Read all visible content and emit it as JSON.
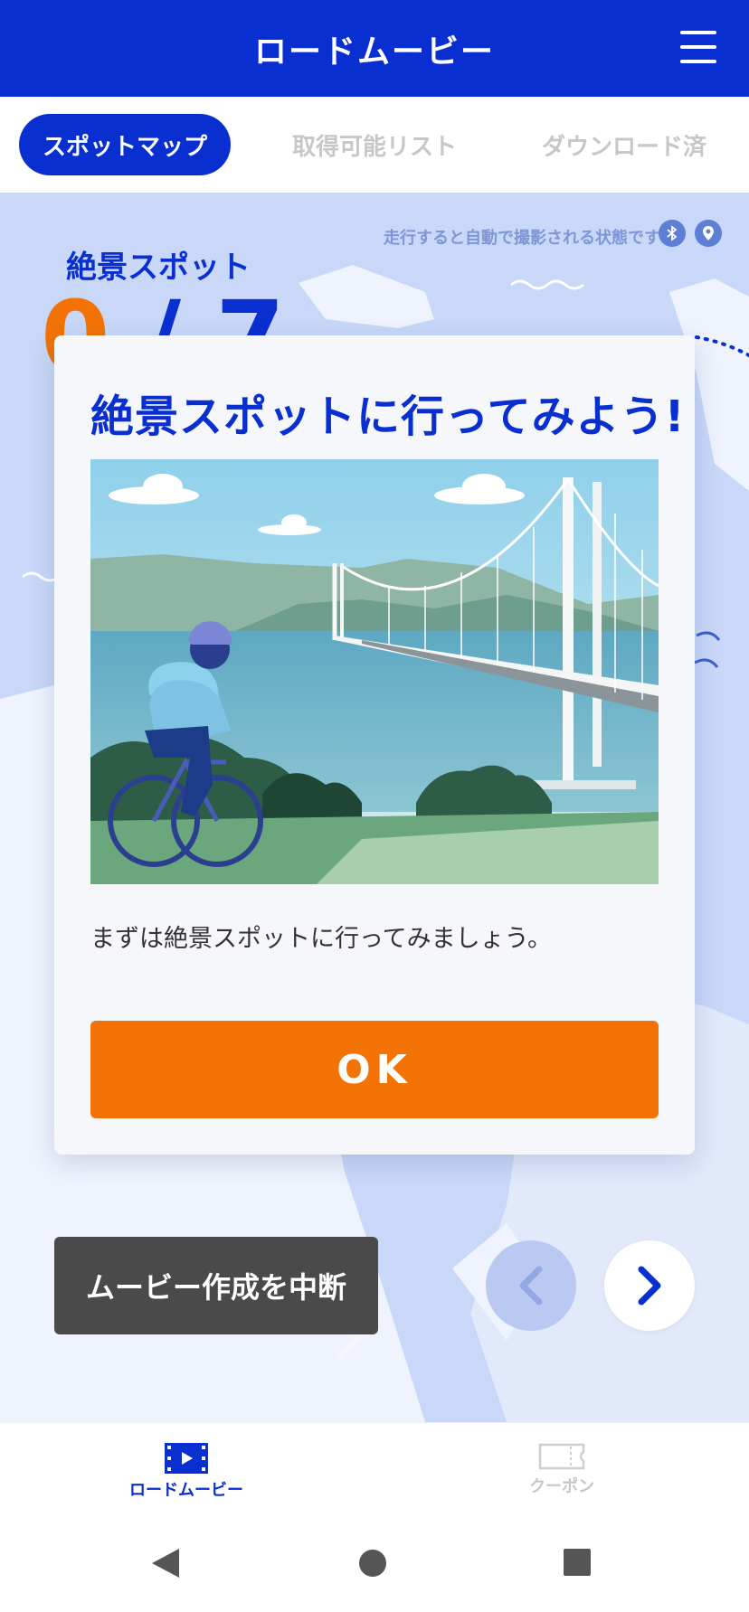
{
  "header": {
    "title": "ロードムービー",
    "menu_icon": "hamburger-menu-icon"
  },
  "tabs": [
    {
      "label": "スポットマップ",
      "active": true
    },
    {
      "label": "取得可能リスト",
      "active": false
    },
    {
      "label": "ダウンロード済",
      "active": false
    }
  ],
  "map": {
    "status_text": "走行すると自動で撮影される状態です",
    "status_icons": [
      "bluetooth-icon",
      "location-pin-icon"
    ],
    "spot_title": "絶景スポット",
    "spot_count_current": "0",
    "spot_count_rest": "/ 7"
  },
  "modal": {
    "title": "絶景スポットに行ってみよう!",
    "message": "まずは絶景スポットに行ってみましょう。",
    "ok_label": "OK"
  },
  "controls": {
    "cancel_label": "ムービー作成を中断",
    "prev_icon": "chevron-left-icon",
    "next_icon": "chevron-right-icon"
  },
  "bottom_nav": [
    {
      "label": "ロードムービー",
      "icon": "movie-icon",
      "active": true
    },
    {
      "label": "クーポン",
      "icon": "ticket-icon",
      "active": false
    }
  ],
  "system_nav": [
    "back-icon",
    "home-icon",
    "recents-icon"
  ],
  "colors": {
    "primary": "#0a2fd0",
    "accent": "#f37306",
    "map_bg": "#c9d8f8",
    "inactive": "#c7c7c7"
  }
}
